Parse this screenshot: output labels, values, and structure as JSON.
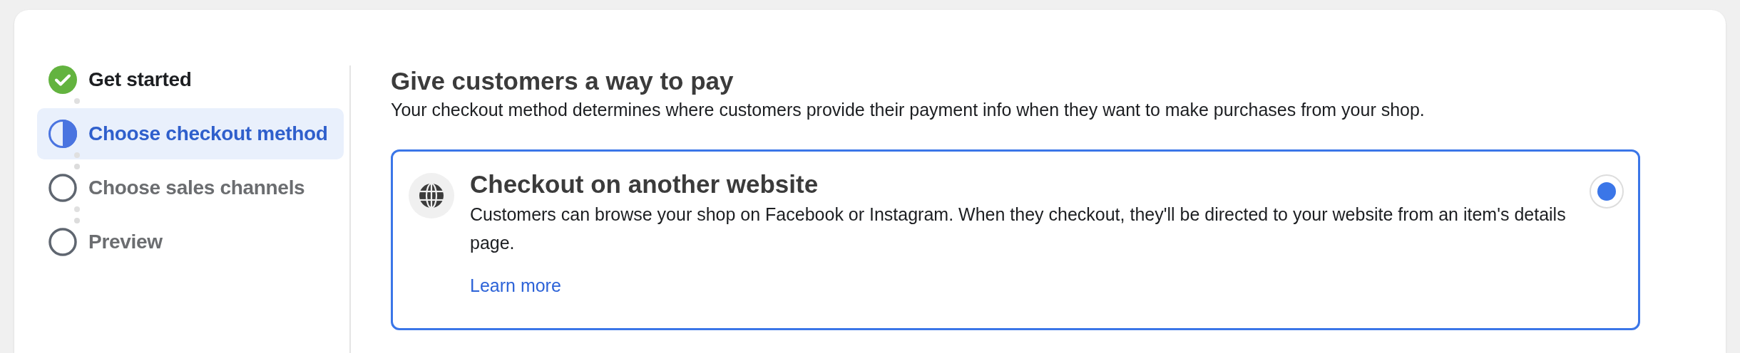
{
  "steps": [
    {
      "label": "Get started",
      "kind": "done",
      "selected": false
    },
    {
      "label": "Choose checkout method",
      "kind": "current",
      "selected": true
    },
    {
      "label": "Choose sales channels",
      "kind": "todo",
      "selected": false
    },
    {
      "label": "Preview",
      "kind": "todo",
      "selected": false
    }
  ],
  "heading": "Give customers a way to pay",
  "subtitle": "Your checkout method determines where customers provide their payment info when they want to make purchases from your shop.",
  "options": [
    {
      "title": "Checkout on another website",
      "description": "Customers can browse your shop on Facebook or Instagram. When they checkout, they'll be directed to your website from an item's details page.",
      "link": "Learn more",
      "selected": true
    }
  ]
}
